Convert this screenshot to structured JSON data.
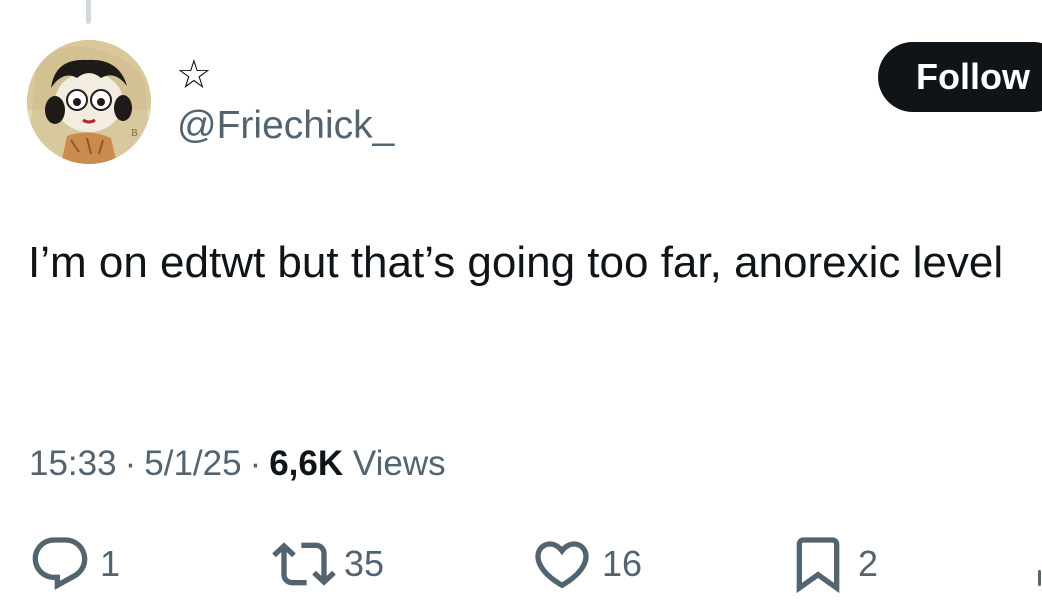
{
  "thread": {
    "connector": "thread-line"
  },
  "author": {
    "display_name": "☆",
    "handle": "@Friechick_",
    "avatar_icon": "avatar-image"
  },
  "follow_button": {
    "label": "Follow"
  },
  "tweet": {
    "text": "I’m on edtwt but that’s going too far, anorexic level",
    "time": "15:33",
    "separator": "·",
    "date": "5/1/25",
    "views_count": "6,6K",
    "views_label": "Views"
  },
  "actions": {
    "reply": {
      "icon": "reply-icon",
      "count": "1"
    },
    "repost": {
      "icon": "repost-icon",
      "count": "35"
    },
    "like": {
      "icon": "heart-icon",
      "count": "16"
    },
    "bookmark": {
      "icon": "bookmark-icon",
      "count": "2"
    }
  },
  "colors": {
    "text_primary": "#0f1419",
    "text_secondary": "#536471",
    "button_bg": "#0f1419",
    "button_text": "#ffffff",
    "divider": "#cfd9de"
  }
}
